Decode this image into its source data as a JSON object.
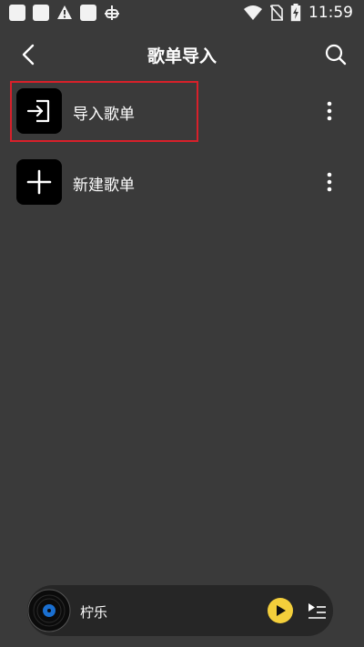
{
  "status_bar": {
    "time": "11:59",
    "icons": [
      "app-square-icon",
      "app-square-icon",
      "warning-icon",
      "app-square-icon",
      "bug-icon",
      "wifi-icon",
      "no-sim-icon",
      "battery-charging-icon"
    ]
  },
  "header": {
    "title": "歌单导入"
  },
  "list": {
    "items": [
      {
        "label": "导入歌单",
        "icon": "import-icon"
      },
      {
        "label": "新建歌单",
        "icon": "plus-icon"
      }
    ]
  },
  "player": {
    "song": "柠乐"
  },
  "colors": {
    "background": "#3a3a3a",
    "highlight": "#d8202a",
    "play_button": "#f4cf3b",
    "player_bar": "#262626"
  }
}
